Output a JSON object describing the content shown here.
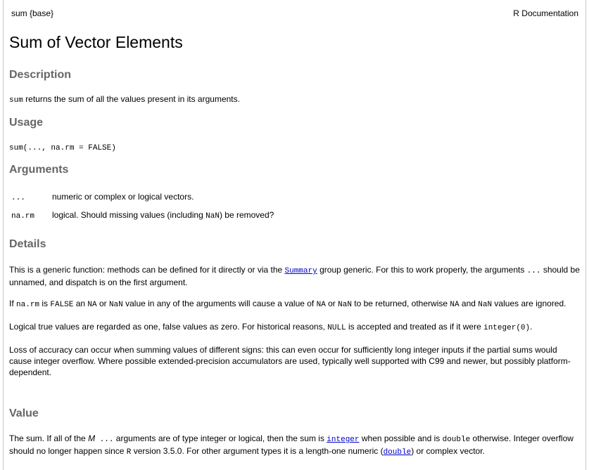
{
  "header": {
    "left": "sum {base}",
    "right": "R Documentation"
  },
  "title": "Sum of Vector Elements",
  "description": {
    "heading": "Description",
    "code": "sum",
    "text": " returns the sum of all the values present in its arguments."
  },
  "usage": {
    "heading": "Usage",
    "code": "sum(..., na.rm = FALSE)"
  },
  "arguments": {
    "heading": "Arguments",
    "items": [
      {
        "name": "...",
        "desc": "numeric or complex or logical vectors."
      },
      {
        "name": "na.rm",
        "desc_pre": "logical. Should missing values (including ",
        "desc_code": "NaN",
        "desc_post": ") be removed?"
      }
    ]
  },
  "details": {
    "heading": "Details",
    "p1": {
      "t1": "This is a generic function: methods can be defined for it directly or via the ",
      "link": "Summary",
      "t2": " group generic. For this to work properly, the arguments ",
      "code": "...",
      "t3": " should be unnamed, and dispatch is on the first argument."
    },
    "p2": {
      "t1": "If ",
      "c1": "na.rm",
      "t2": " is ",
      "c2": "FALSE",
      "t3": " an ",
      "c3": "NA",
      "t4": " or ",
      "c4": "NaN",
      "t5": " value in any of the arguments will cause a value of ",
      "c5": "NA",
      "t6": " or ",
      "c6": "NaN",
      "t7": " to be returned, otherwise ",
      "c7": "NA",
      "t8": " and ",
      "c8": "NaN",
      "t9": " values are ignored."
    },
    "p3": {
      "t1": "Logical true values are regarded as one, false values as zero. For historical reasons, ",
      "c1": "NULL",
      "t2": " is accepted and treated as if it were ",
      "c2": "integer(0)",
      "t3": "."
    },
    "p4": "Loss of accuracy can occur when summing values of different signs: this can even occur for sufficiently long integer inputs if the partial sums would cause integer overflow. Where possible extended-precision accumulators are used, typically well supported with C99 and newer, but possibly platform-dependent."
  },
  "value": {
    "heading": "Value",
    "t1": "The sum. If all of the ",
    "em": "M",
    "c1": " ...",
    "t2": " arguments are of type integer or logical, then the sum is ",
    "link1": "integer",
    "t3": " when possible and is ",
    "c2": "double",
    "t4": " otherwise. Integer overflow should no longer happen since ",
    "c3": "R",
    "t5": " version 3.5.0. For other argument types it is a length-one numeric (",
    "link2": "double",
    "t6": ") or complex vector."
  }
}
